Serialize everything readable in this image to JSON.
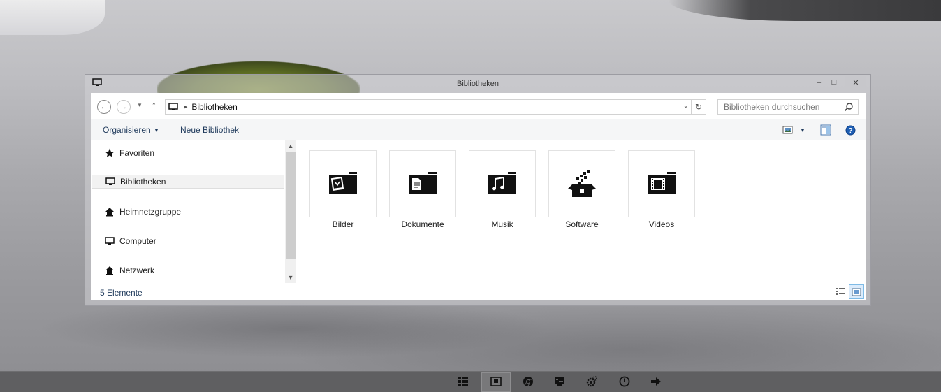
{
  "window": {
    "title": "Bibliotheken",
    "minimize_glyph": "–",
    "maximize_glyph": "□",
    "close_glyph": "✕"
  },
  "address": {
    "back_glyph": "←",
    "forward_glyph": "→",
    "history_glyph": "▼",
    "up_glyph": "↑",
    "separator_glyph": "▶",
    "path": "Bibliotheken",
    "dropdown_glyph": "⌄",
    "refresh_glyph": "↻",
    "search_placeholder": "Bibliotheken durchsuchen"
  },
  "commandbar": {
    "organize_label": "Organisieren",
    "organize_arrow": "▼",
    "new_library_label": "Neue Bibliothek",
    "view_arrow": "▼"
  },
  "navpane": {
    "items": [
      {
        "label": "Favoriten",
        "icon": "star-icon"
      },
      {
        "label": "Bibliotheken",
        "icon": "computer-icon",
        "selected": true
      },
      {
        "label": "Heimnetzgruppe",
        "icon": "homegroup-icon"
      },
      {
        "label": "Computer",
        "icon": "computer-icon"
      },
      {
        "label": "Netzwerk",
        "icon": "network-icon"
      }
    ],
    "scroll_up_glyph": "▲",
    "scroll_down_glyph": "▼"
  },
  "libraries": [
    {
      "label": "Bilder",
      "icon": "pictures-library-icon"
    },
    {
      "label": "Dokumente",
      "icon": "documents-library-icon"
    },
    {
      "label": "Musik",
      "icon": "music-library-icon"
    },
    {
      "label": "Software",
      "icon": "software-library-icon"
    },
    {
      "label": "Videos",
      "icon": "videos-library-icon"
    }
  ],
  "status": {
    "item_count": "5 Elemente"
  },
  "taskbar": {
    "buttons": [
      {
        "icon": "start-grid-icon",
        "active": false
      },
      {
        "icon": "explorer-icon",
        "active": true
      },
      {
        "icon": "chrome-icon",
        "active": false
      },
      {
        "icon": "control-panel-icon",
        "active": false
      },
      {
        "icon": "settings-icon",
        "active": false
      },
      {
        "icon": "power-icon",
        "active": false
      },
      {
        "icon": "arrow-right-icon",
        "active": false
      }
    ]
  },
  "colors": {
    "accent": "#1e395b",
    "selection_border": "#7fbbe6",
    "taskbar": "#5f5f61"
  }
}
